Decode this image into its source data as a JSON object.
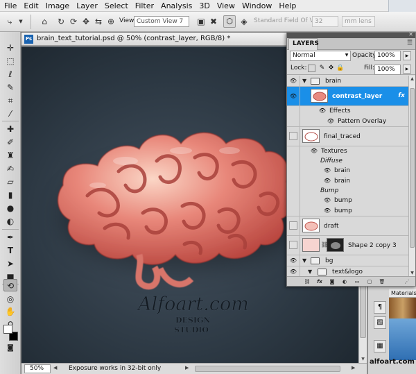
{
  "menu": [
    "File",
    "Edit",
    "Image",
    "Layer",
    "Select",
    "Filter",
    "Analysis",
    "3D",
    "View",
    "Window",
    "Help"
  ],
  "options": {
    "view_label": "View:",
    "view_value": "Custom View 7",
    "fov_label": "Standard Field Of View:",
    "fov_value": "32",
    "lens_value": "mm lens"
  },
  "document": {
    "tab_icon": "Ps",
    "title": "brain_text_tutorial.psd @ 50% (contrast_layer, RGB/8) *",
    "watermark_main": "Alfoart.com",
    "watermark_sub1": "DESIGN",
    "watermark_sub2": "STUDIO",
    "zoom": "50%",
    "status_message": "Exposure works in 32-bit only",
    "canvas_color": "#2d3944"
  },
  "dock": {
    "materials_label": "Materials",
    "brand": "alfoart.com"
  },
  "layers_panel": {
    "tab": "LAYERS",
    "blend_mode": "Normal",
    "opacity_label": "Opacity:",
    "opacity_value": "100%",
    "lock_label": "Lock:",
    "fill_label": "Fill:",
    "fill_value": "100%",
    "accent_color": "#1a8fe8",
    "rows": [
      {
        "name": "brain",
        "kind": "group"
      },
      {
        "name": "contrast_layer",
        "kind": "layer",
        "fx": "fx"
      },
      {
        "name": "Effects",
        "kind": "effects"
      },
      {
        "name": "Pattern Overlay",
        "kind": "effect"
      },
      {
        "name": "final_traced",
        "kind": "layer"
      },
      {
        "name": "Textures",
        "kind": "effects"
      },
      {
        "name": "Diffuse",
        "kind": "subhead"
      },
      {
        "name": "brain",
        "kind": "texture"
      },
      {
        "name": "brain",
        "kind": "texture"
      },
      {
        "name": "Bump",
        "kind": "subhead"
      },
      {
        "name": "bump",
        "kind": "texture"
      },
      {
        "name": "bump",
        "kind": "texture"
      },
      {
        "name": "draft",
        "kind": "layer"
      },
      {
        "name": "Shape 2 copy 3",
        "kind": "shape"
      },
      {
        "name": "bg",
        "kind": "group"
      },
      {
        "name": "text&logo",
        "kind": "group"
      }
    ]
  }
}
